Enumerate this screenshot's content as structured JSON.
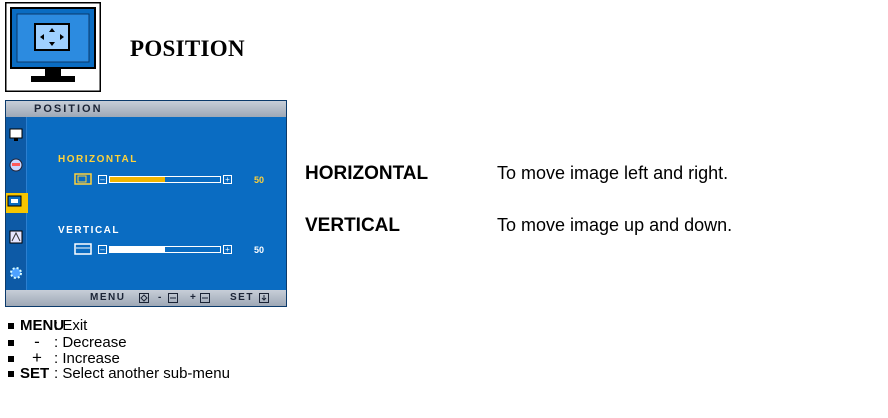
{
  "page": {
    "title": "POSITION"
  },
  "osd": {
    "title": "POSITION",
    "horizontal": {
      "label": "HORIZONTAL",
      "value": "50",
      "level": 0.5
    },
    "vertical": {
      "label": "VERTICAL",
      "value": "50",
      "level": 0.5
    },
    "footer": {
      "menu": "MENU",
      "minus": "-",
      "plus": "+",
      "set": "SET"
    }
  },
  "descriptions": [
    {
      "term": "HORIZONTAL",
      "text": "To move image left and right."
    },
    {
      "term": "VERTICAL",
      "text": "To move image up and down."
    }
  ],
  "legend": [
    {
      "key": "MENU",
      "text": ": Exit"
    },
    {
      "key": "-",
      "text": ": Decrease"
    },
    {
      "key": "+",
      "text": ": Increase"
    },
    {
      "key": "SET",
      "text": ": Select another sub-menu"
    }
  ],
  "colors": {
    "osd_bg": "#0a6cc2",
    "accent": "#f2b600",
    "highlight": "#ffd23a"
  }
}
